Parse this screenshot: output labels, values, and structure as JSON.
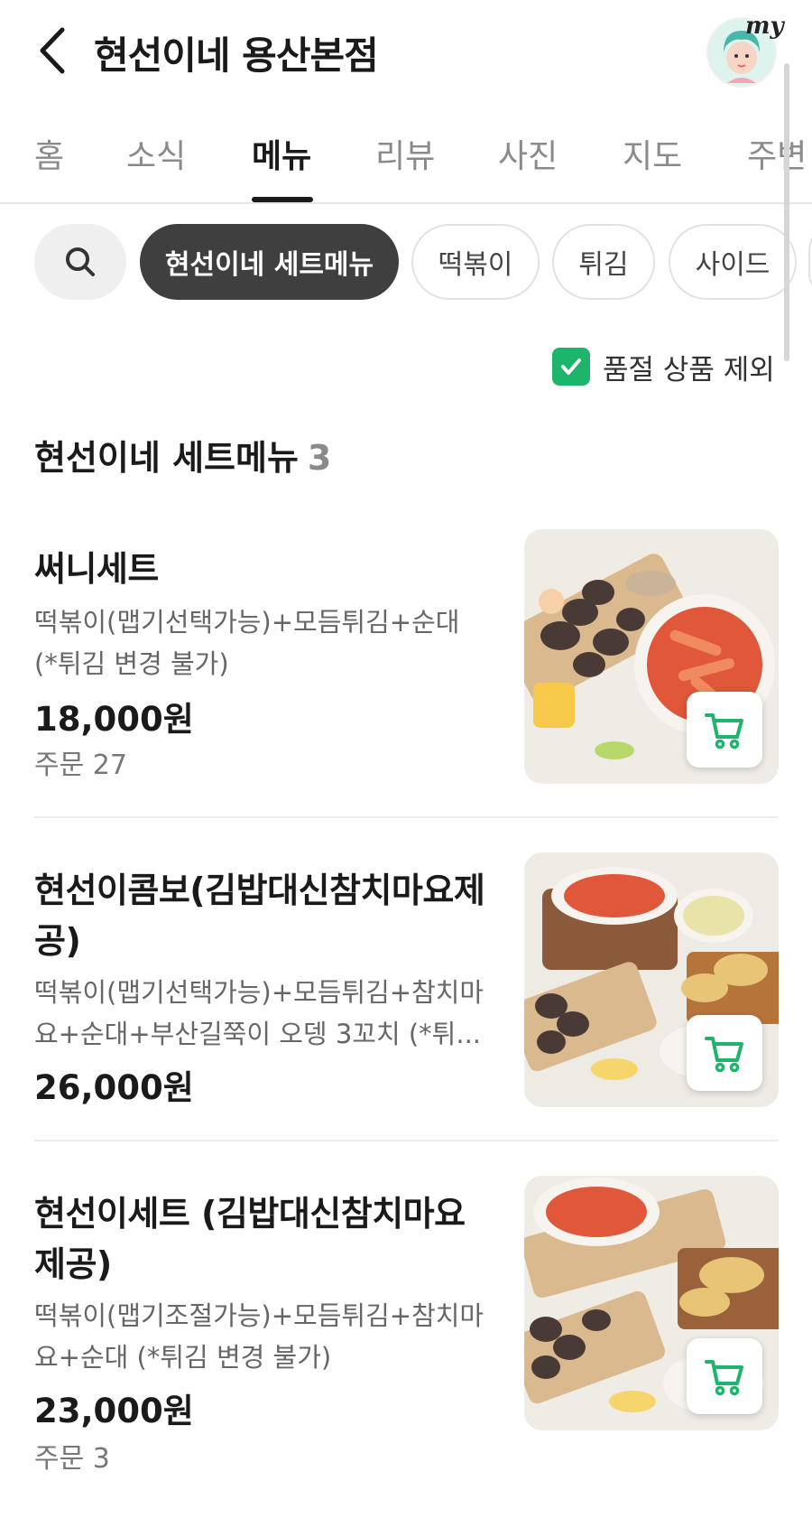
{
  "header": {
    "title": "현선이네 용산본점",
    "my_label": "my"
  },
  "tabs": [
    {
      "label": "홈"
    },
    {
      "label": "소식"
    },
    {
      "label": "메뉴"
    },
    {
      "label": "리뷰"
    },
    {
      "label": "사진"
    },
    {
      "label": "지도"
    },
    {
      "label": "주변"
    }
  ],
  "active_tab": "메뉴",
  "categories": [
    {
      "label": "현선이네 세트메뉴"
    },
    {
      "label": "떡볶이"
    },
    {
      "label": "튀김"
    },
    {
      "label": "사이드"
    }
  ],
  "filter": {
    "label": "품절 상품 제외",
    "checked": true
  },
  "section": {
    "title": "현선이네 세트메뉴",
    "count": "3"
  },
  "items": [
    {
      "name": "써니세트",
      "desc": "떡볶이(맵기선택가능)+모듬튀김+순대 (*튀김 변경 불가)",
      "price": "18,000원",
      "orders": "주문 27"
    },
    {
      "name": "현선이콤보(김밥대신참치마요제공)",
      "desc": "떡볶이(맵기선택가능)+모듬튀김+참치마요+순대+부산길쭉이 오뎅 3꼬치 (*튀...",
      "price": "26,000원",
      "orders": ""
    },
    {
      "name": "현선이세트 (김밥대신참치마요제공)",
      "desc": "떡볶이(맵기조절가능)+모듬튀김+참치마요+순대 (*튀김 변경 불가)",
      "price": "23,000원",
      "orders": "주문 3"
    }
  ],
  "colors": {
    "accent_green": "#1db56b",
    "active_chip": "#3f3f3f"
  }
}
